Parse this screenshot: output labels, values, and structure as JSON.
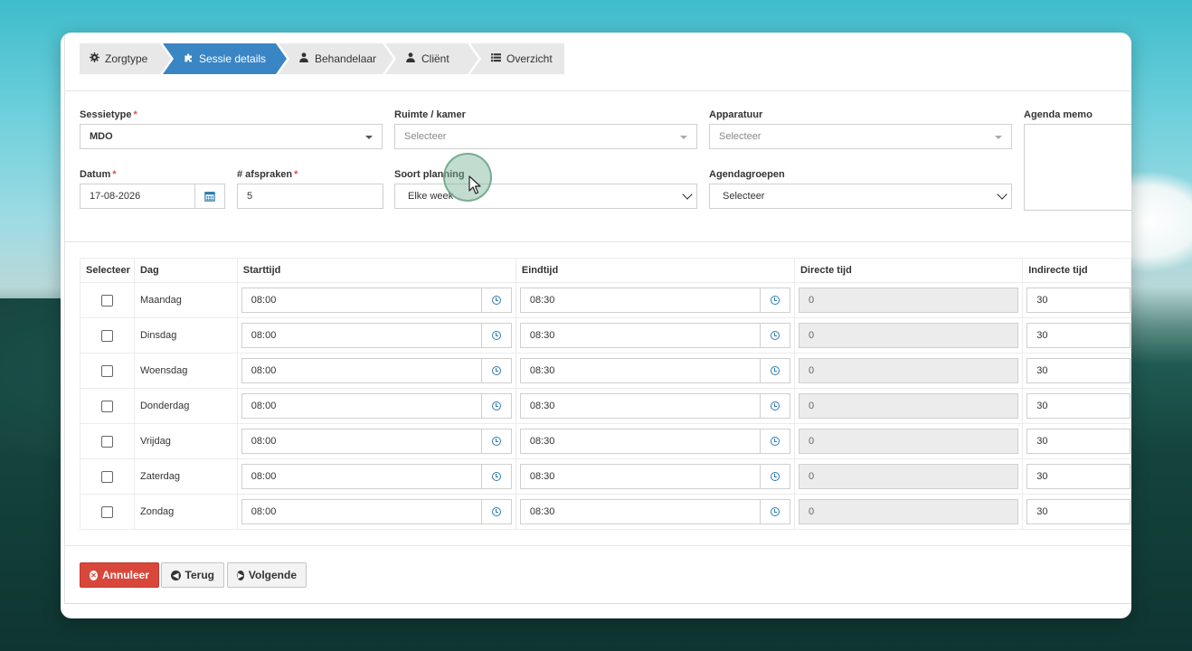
{
  "wizard": {
    "steps": [
      {
        "label": "Zorgtype",
        "icon": "gear-icon"
      },
      {
        "label": "Sessie details",
        "icon": "puzzle-icon"
      },
      {
        "label": "Behandelaar",
        "icon": "user-icon"
      },
      {
        "label": "Cliënt",
        "icon": "user-icon"
      },
      {
        "label": "Overzicht",
        "icon": "list-icon"
      }
    ],
    "active_index": 1
  },
  "form": {
    "sessietype": {
      "label": "Sessietype",
      "value": "MDO"
    },
    "ruimte": {
      "label": "Ruimte / kamer",
      "placeholder": "Selecteer"
    },
    "apparatuur": {
      "label": "Apparatuur",
      "placeholder": "Selecteer"
    },
    "agenda_memo": {
      "label": "Agenda memo",
      "value": ""
    },
    "datum": {
      "label": "Datum",
      "value": "17-08-2026"
    },
    "afspraken": {
      "label": "# afspraken",
      "value": "5"
    },
    "soort_planning": {
      "label": "Soort planning",
      "value": "Elke week"
    },
    "agendagroepen": {
      "label": "Agendagroepen",
      "value": "Selecteer"
    }
  },
  "table": {
    "headers": [
      "Selecteer",
      "Dag",
      "Starttijd",
      "Eindtijd",
      "Directe tijd",
      "Indirecte tijd"
    ],
    "rows": [
      {
        "day": "Maandag",
        "start": "08:00",
        "end": "08:30",
        "direct": "0",
        "indirect": "30"
      },
      {
        "day": "Dinsdag",
        "start": "08:00",
        "end": "08:30",
        "direct": "0",
        "indirect": "30"
      },
      {
        "day": "Woensdag",
        "start": "08:00",
        "end": "08:30",
        "direct": "0",
        "indirect": "30"
      },
      {
        "day": "Donderdag",
        "start": "08:00",
        "end": "08:30",
        "direct": "0",
        "indirect": "30"
      },
      {
        "day": "Vrijdag",
        "start": "08:00",
        "end": "08:30",
        "direct": "0",
        "indirect": "30"
      },
      {
        "day": "Zaterdag",
        "start": "08:00",
        "end": "08:30",
        "direct": "0",
        "indirect": "30"
      },
      {
        "day": "Zondag",
        "start": "08:00",
        "end": "08:30",
        "direct": "0",
        "indirect": "30"
      }
    ]
  },
  "buttons": {
    "annuleer": "Annuleer",
    "terug": "Terug",
    "volgende": "Volgende"
  },
  "colors": {
    "accent": "#3a85c4",
    "danger": "#d9473b",
    "required": "#d9534f"
  }
}
